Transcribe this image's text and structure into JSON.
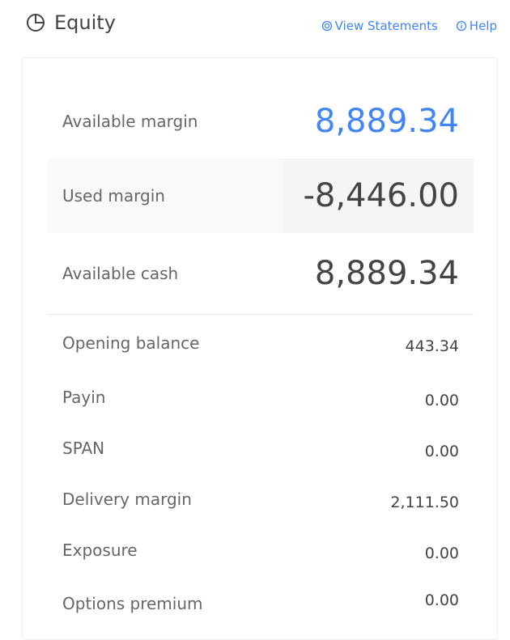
{
  "header": {
    "title": "Equity",
    "icon": "pie-chart-icon",
    "links": [
      {
        "label": "View Statements",
        "icon": "target-icon"
      },
      {
        "label": "Help",
        "icon": "info-icon"
      }
    ]
  },
  "summary": {
    "available_margin": {
      "label": "Available margin",
      "value": "8,889.34"
    },
    "used_margin": {
      "label": "Used margin",
      "value": "-8,446.00"
    },
    "available_cash": {
      "label": "Available cash",
      "value": "8,889.34"
    }
  },
  "details": [
    {
      "label": "Opening balance",
      "value": "443.34"
    },
    {
      "label": "Payin",
      "value": "0.00"
    },
    {
      "label": "SPAN",
      "value": "0.00"
    },
    {
      "label": "Delivery margin",
      "value": "2,111.50"
    },
    {
      "label": "Exposure",
      "value": "0.00"
    },
    {
      "label": "Options premium",
      "value": "0.00"
    }
  ],
  "colors": {
    "accent": "#4184f3",
    "text": "#444444",
    "muted": "#666666"
  }
}
